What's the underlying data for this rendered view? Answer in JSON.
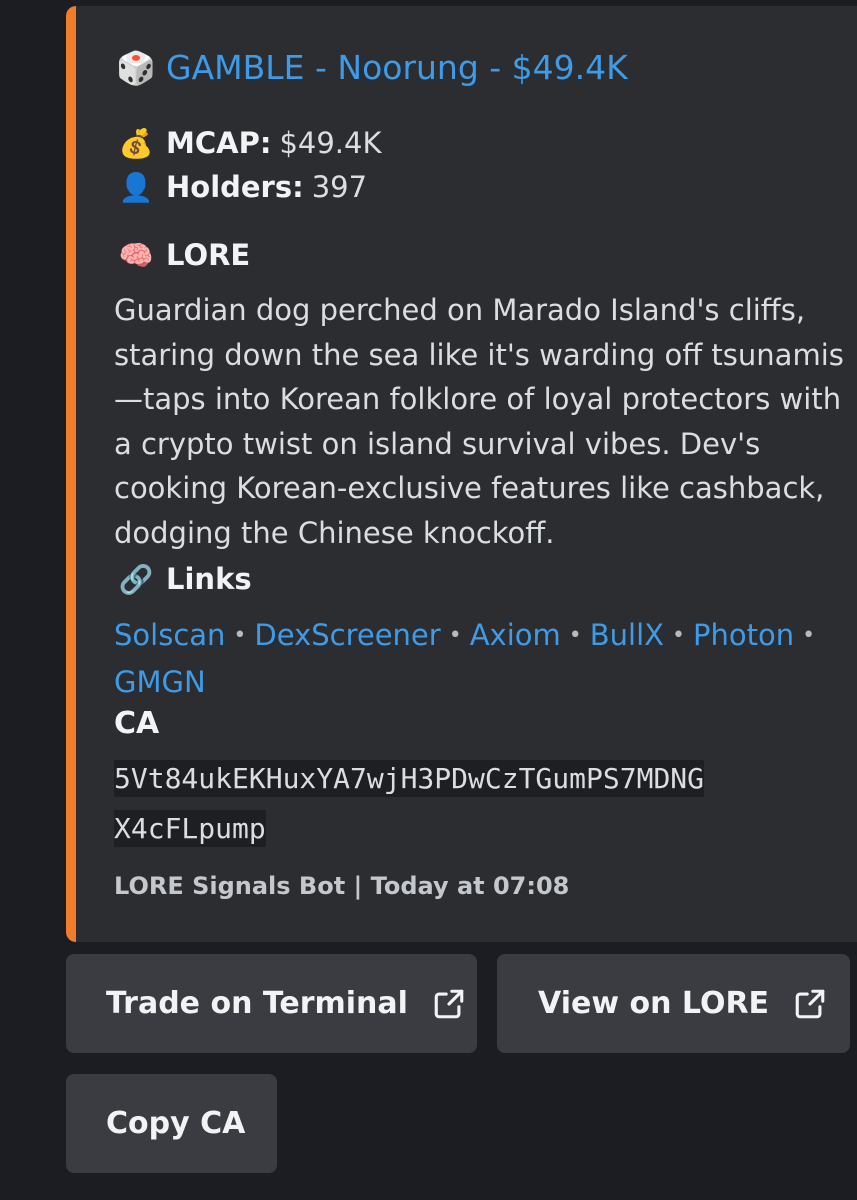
{
  "embed": {
    "accent_color": "#f07c2c",
    "title_emoji": "🎲",
    "title": "GAMBLE - Noorung - $49.4K",
    "mcap_emoji": "💰",
    "mcap_label": "MCAP:",
    "mcap_value": "$49.4K",
    "holders_emoji": "👤",
    "holders_label": "Holders:",
    "holders_value": "397",
    "lore_emoji": "🧠",
    "lore_heading": "LORE",
    "lore_text": "Guardian dog perched on Marado Island's cliffs, staring down the sea like it's warding off tsunamis—taps into Korean folklore of loyal protectors with a crypto twist on island survival vibes. Dev's cooking Korean-exclusive features like cashback, dodging the Chinese knockoff.",
    "links_emoji": "🔗",
    "links_heading": "Links",
    "links": [
      "Solscan",
      "DexScreener",
      "Axiom",
      "BullX",
      "Photon",
      "GMGN"
    ],
    "separator": "•",
    "ca_label": "CA",
    "ca_line1": "5Vt84ukEKHuxYA7wjH3PDwCzTGumPS7MDNG",
    "ca_line2": "X4cFLpump",
    "footer": "LORE Signals Bot | Today at 07:08"
  },
  "buttons": {
    "trade": "Trade on Terminal",
    "view": "View on LORE",
    "copy": "Copy CA"
  },
  "icons": {
    "external_link": "external-link-icon"
  }
}
